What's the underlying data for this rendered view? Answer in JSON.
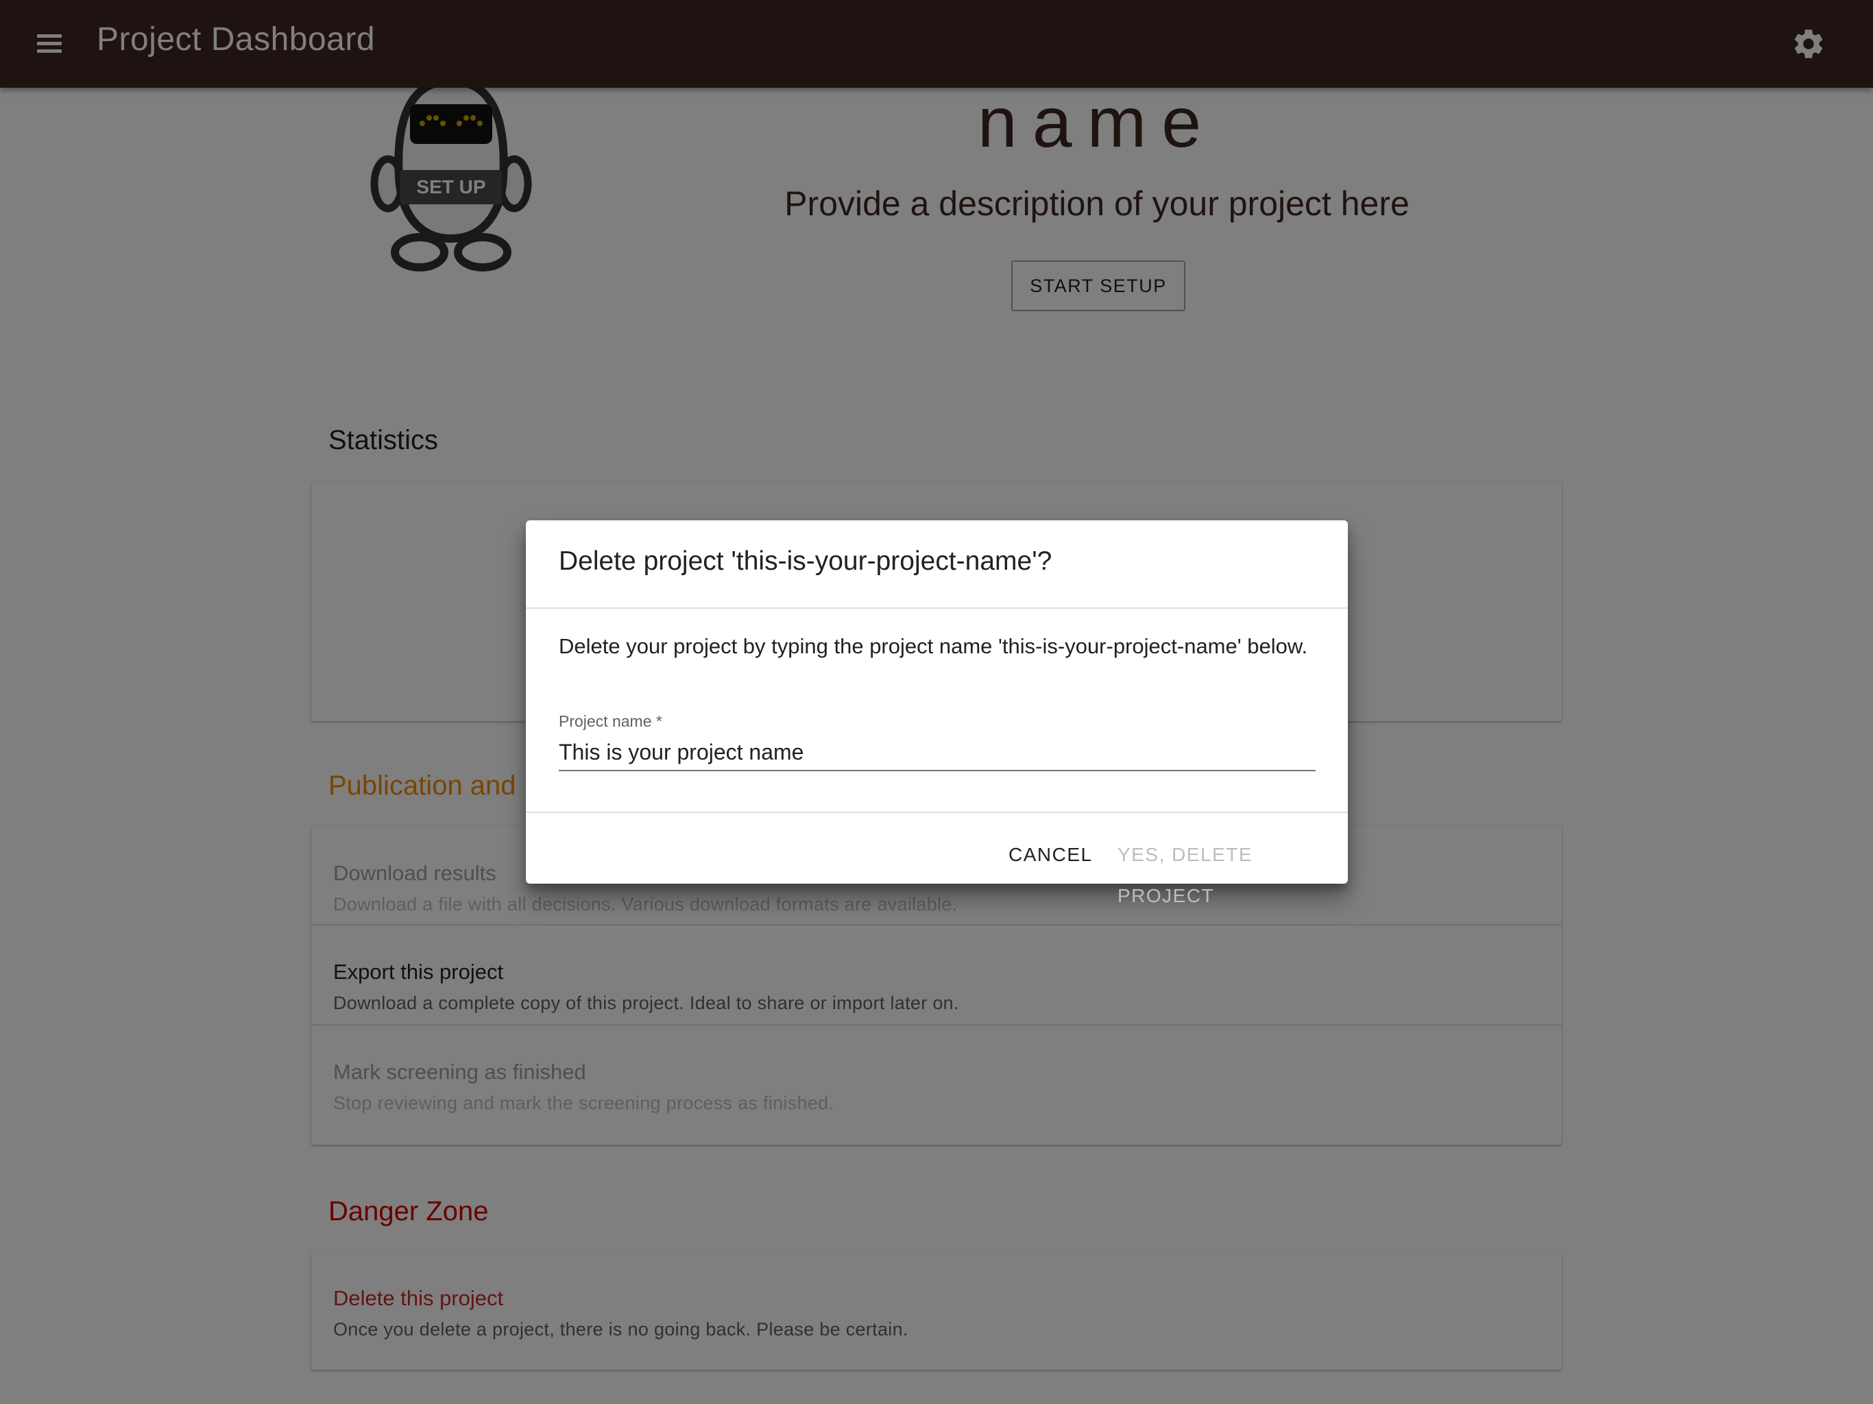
{
  "appbar": {
    "title": "Project Dashboard",
    "menu_icon": "menu-icon",
    "settings_icon": "gear-icon",
    "color": "#3e2723"
  },
  "hero": {
    "robot_label": "SET UP",
    "project_name_partial": "name",
    "description": "Provide a description of your project here",
    "setup_button": "START SETUP"
  },
  "statistics": {
    "title": "Statistics"
  },
  "publication": {
    "title": "Publication and",
    "title_color": "#f28a00",
    "items": [
      {
        "title": "Download results",
        "subtitle": "Download a file with all decisions. Various download formats are available."
      },
      {
        "title": "Export this project",
        "subtitle": "Download a complete copy of this project. Ideal to share or import later on."
      },
      {
        "title": "Mark screening as finished",
        "subtitle": "Stop reviewing and mark the screening process as finished."
      }
    ]
  },
  "danger_zone": {
    "title": "Danger Zone",
    "title_color": "#d50000",
    "item": {
      "title": "Delete this project",
      "subtitle": "Once you delete a project, there is no going back. Please be certain."
    }
  },
  "dialog": {
    "title": "Delete project 'this-is-your-project-name'?",
    "text": "Delete your project by typing the project name 'this-is-your-project-name' below.",
    "field_label": "Project name *",
    "field_value": "This is your project name",
    "cancel_label": "CANCEL",
    "confirm_label": "YES, DELETE PROJECT"
  }
}
